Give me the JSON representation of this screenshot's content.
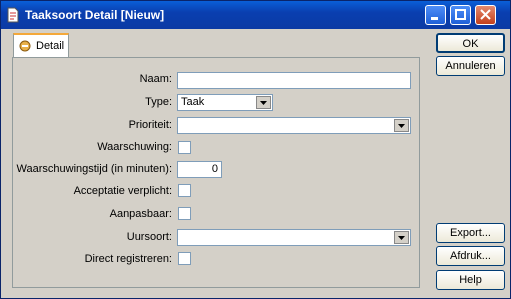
{
  "window": {
    "title": "Taaksoort Detail [Nieuw]"
  },
  "tabs": [
    {
      "label": "Detail"
    }
  ],
  "form": {
    "naam": {
      "label": "Naam:",
      "value": ""
    },
    "type": {
      "label": "Type:",
      "value": "Taak"
    },
    "prioriteit": {
      "label": "Prioriteit:",
      "value": ""
    },
    "waarschuwing": {
      "label": "Waarschuwing:",
      "checked": false
    },
    "waarschuwingstijd": {
      "label": "Waarschuwingstijd (in minuten):",
      "value": "0"
    },
    "acceptatie": {
      "label": "Acceptatie verplicht:",
      "checked": false
    },
    "aanpasbaar": {
      "label": "Aanpasbaar:",
      "checked": false
    },
    "uursoort": {
      "label": "Uursoort:",
      "value": ""
    },
    "direct": {
      "label": "Direct registreren:",
      "checked": false
    }
  },
  "buttons": {
    "ok": "OK",
    "annuleren": "Annuleren",
    "export": "Export...",
    "afdruk": "Afdruk...",
    "help": "Help"
  }
}
